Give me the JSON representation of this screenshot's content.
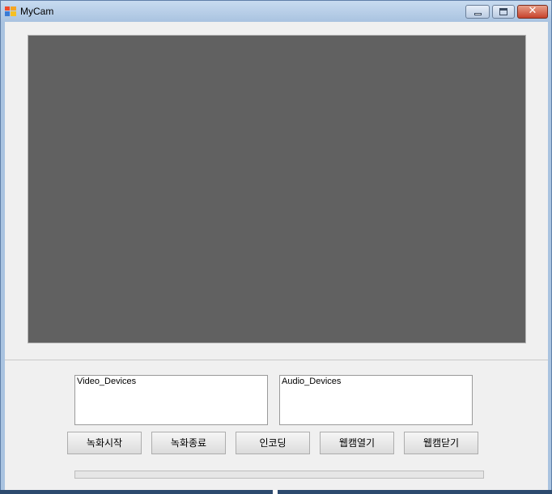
{
  "window": {
    "title": "MyCam",
    "close_glyph": "✕",
    "icons": {
      "app": "app-icon",
      "minimize": "minimize-icon",
      "maximize": "maximize-icon",
      "close": "close-icon"
    }
  },
  "lists": {
    "video_devices": "Video_Devices",
    "audio_devices": "Audio_Devices"
  },
  "buttons": {
    "record_start": "녹화시작",
    "record_stop": "녹화종료",
    "encoding": "인코딩",
    "webcam_open": "웹캠열기",
    "webcam_close": "웹캠닫기"
  },
  "progress": {
    "value": 0
  },
  "colors": {
    "video_background": "#616161",
    "client_background": "#f0f0f0",
    "close_button": "#c7422c"
  }
}
